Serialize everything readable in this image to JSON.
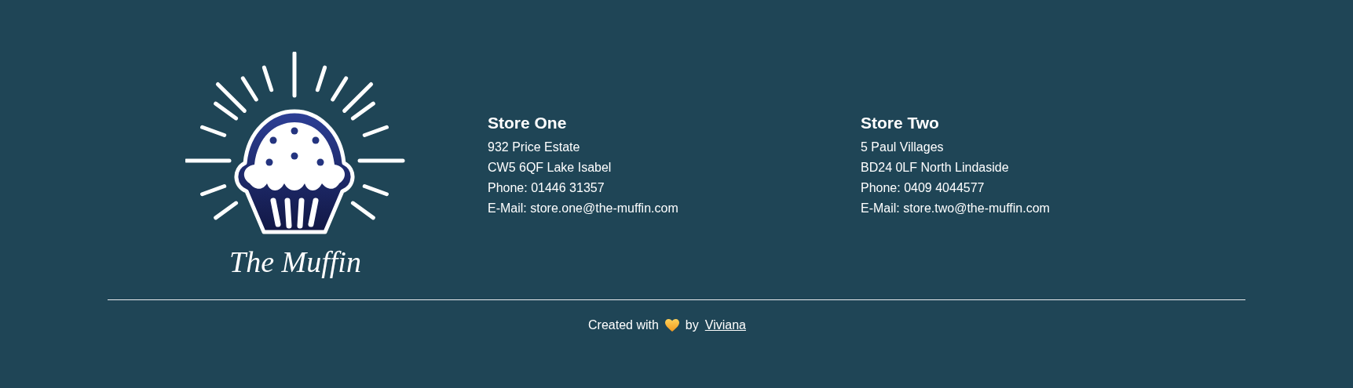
{
  "logo": {
    "text": "The Muffin"
  },
  "stores": [
    {
      "title": "Store One",
      "lines": [
        "932 Price Estate",
        "CW5 6QF Lake Isabel",
        "Phone: 01446 31357",
        "E-Mail: store.one@the-muffin.com"
      ]
    },
    {
      "title": "Store Two",
      "lines": [
        "5 Paul Villages",
        "BD24 0LF North Lindaside",
        "Phone: 0409 4044577",
        "E-Mail: store.two@the-muffin.com"
      ]
    }
  ],
  "credit": {
    "before": "Created with",
    "after": "by",
    "author": "Viviana"
  }
}
